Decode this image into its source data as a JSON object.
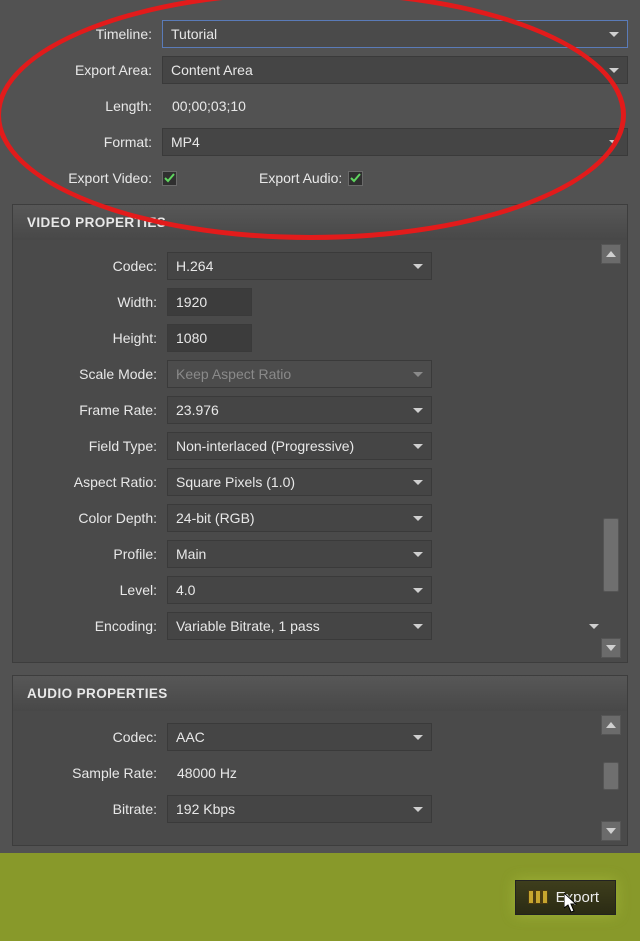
{
  "top": {
    "timeline_label": "Timeline:",
    "timeline_value": "Tutorial",
    "export_area_label": "Export Area:",
    "export_area_value": "Content Area",
    "length_label": "Length:",
    "length_value": "00;00;03;10",
    "format_label": "Format:",
    "format_value": "MP4",
    "export_video_label": "Export Video:",
    "export_video_checked": true,
    "export_audio_label": "Export Audio:",
    "export_audio_checked": true
  },
  "video": {
    "header": "VIDEO PROPERTIES",
    "codec_label": "Codec:",
    "codec_value": "H.264",
    "width_label": "Width:",
    "width_value": "1920",
    "height_label": "Height:",
    "height_value": "1080",
    "scale_mode_label": "Scale Mode:",
    "scale_mode_value": "Keep Aspect Ratio",
    "frame_rate_label": "Frame Rate:",
    "frame_rate_value": "23.976",
    "field_type_label": "Field Type:",
    "field_type_value": "Non-interlaced (Progressive)",
    "aspect_ratio_label": "Aspect Ratio:",
    "aspect_ratio_value": "Square Pixels (1.0)",
    "color_depth_label": "Color Depth:",
    "color_depth_value": "24-bit (RGB)",
    "profile_label": "Profile:",
    "profile_value": "Main",
    "level_label": "Level:",
    "level_value": "4.0",
    "encoding_label": "Encoding:",
    "encoding_value": "Variable Bitrate, 1 pass"
  },
  "audio": {
    "header": "AUDIO PROPERTIES",
    "codec_label": "Codec:",
    "codec_value": "AAC",
    "sample_rate_label": "Sample Rate:",
    "sample_rate_value": "48000 Hz",
    "bitrate_label": "Bitrate:",
    "bitrate_value": "192 Kbps"
  },
  "footer": {
    "export_button": "Export"
  }
}
